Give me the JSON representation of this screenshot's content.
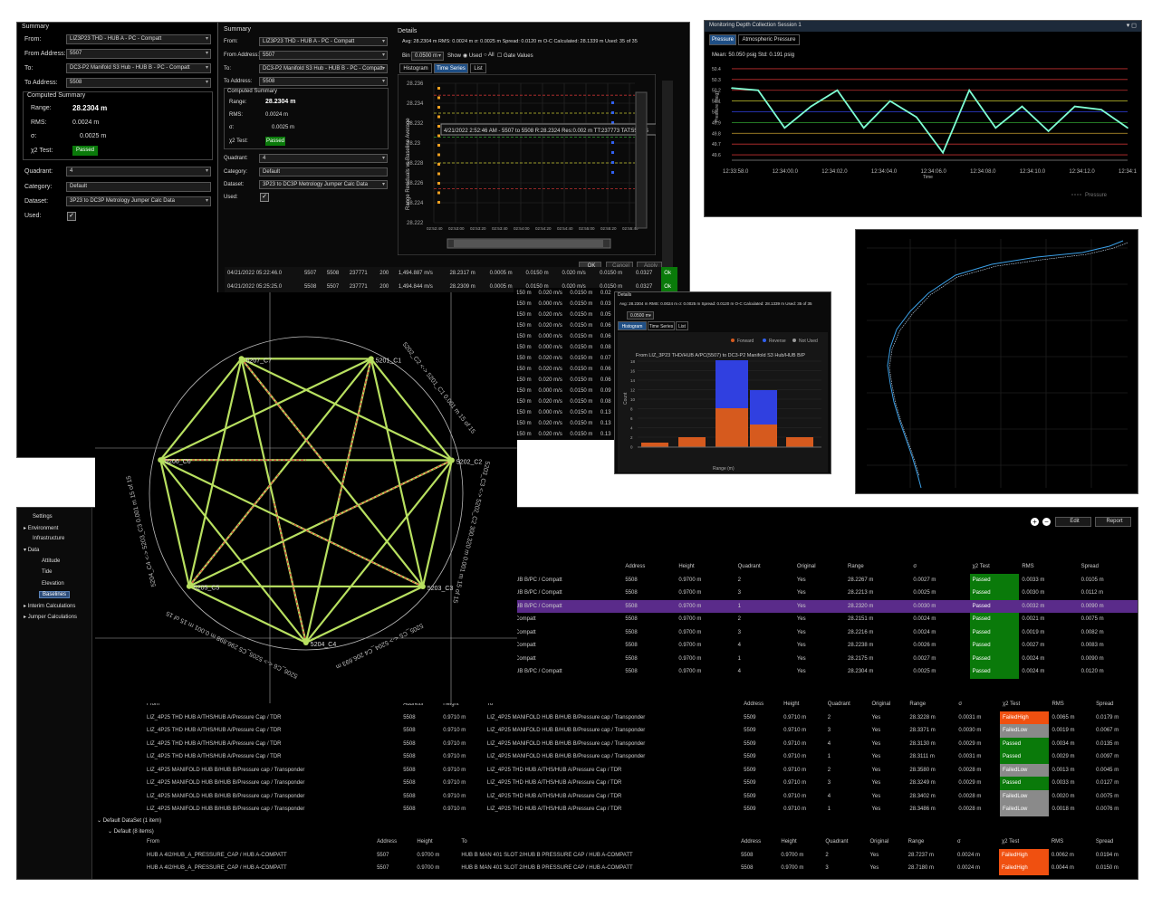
{
  "summary_panel": {
    "title": "Summary",
    "from_label": "From:",
    "from_value": "LIZ3P23 THD - HUB A - PC - Compatt",
    "from_address_label": "From Address:",
    "from_address_value": "5507",
    "to_label": "To:",
    "to_value": "DC3-P2 Manifold S3 Hub - HUB B - PC - Compatt",
    "to_address_label": "To Address:",
    "to_address_value": "5508",
    "computed_summary_title": "Computed Summary",
    "range_label": "Range:",
    "range_value": "28.2304 m",
    "rms_label": "RMS:",
    "rms_value": "0.0024 m",
    "sigma_label": "σ:",
    "sigma_value": "0.0025 m",
    "chi_label": "χ2 Test:",
    "chi_value": "Passed",
    "quadrant_label": "Quadrant:",
    "quadrant_value": "4",
    "category_label": "Category:",
    "category_value": "Default",
    "dataset_label": "Dataset:",
    "dataset_value": "3P23 to DC3P Metrology Jumper Calc Data",
    "used_label": "Used:"
  },
  "details_panel": {
    "title": "Details",
    "stats": "Avg: 28.2304 m  RMS: 0.0024 m  σ: 0.0025 m  Spread: 0.0120 m  O-C  Calculated: 28.1339 m  Used: 35 of 35",
    "bin_label": "Bin",
    "bin_value": "0.0500 m",
    "show_label": "Show",
    "used_option": "Used",
    "all_option": "All",
    "gate_label": "Gate Values",
    "tabs": [
      "Histogram",
      "Time Series",
      "List"
    ],
    "y_axis_label": "Range Residuals vs Baseline Average",
    "y_ticks": [
      "28.236",
      "28.234",
      "28.232",
      "28.23",
      "28.228",
      "28.226",
      "28.224",
      "28.222"
    ],
    "x_ticks": [
      "02:52:40",
      "02:53:00",
      "02:53:20",
      "02:53:40",
      "02:54:00",
      "02:54:20",
      "02:54:40",
      "02:55:00",
      "02:55:20",
      "02:55:40"
    ],
    "tooltip": "4/21/2022 2:52:46 AM - 5507 to 5508 R:28.2324 Res:0.002 m TT:237773 TAT:5508 S",
    "ok": "OK",
    "cancel": "Cancel",
    "apply": "Apply"
  },
  "bg_rows": [
    {
      "time": "04/21/2022 05:22:46.0",
      "a": "5507",
      "b": "5508",
      "c": "237771",
      "d": "200",
      "e": "1,494.887 m/s",
      "f": "28.2317 m",
      "g": "0.0005 m",
      "h": "0.0150 m",
      "i": "0.020 m/s",
      "j": "0.0150 m",
      "k": "0.0327",
      "ok": "Ok"
    },
    {
      "time": "04/21/2022 05:25:25.0",
      "a": "5508",
      "b": "5507",
      "c": "237771",
      "d": "200",
      "e": "1,494.844 m/s",
      "f": "28.2309 m",
      "g": "0.0005 m",
      "h": "0.0150 m",
      "i": "0.020 m/s",
      "j": "0.0150 m",
      "k": "0.0327",
      "ok": "Ok"
    }
  ],
  "mid_rows": [
    [
      "150 m",
      "0.020 m/s",
      "0.0150 m",
      "0.02"
    ],
    [
      "150 m",
      "0.000 m/s",
      "0.0150 m",
      "0.03"
    ],
    [
      "150 m",
      "0.020 m/s",
      "0.0150 m",
      "0.05"
    ],
    [
      "150 m",
      "0.020 m/s",
      "0.0150 m",
      "0.06"
    ],
    [
      "150 m",
      "0.000 m/s",
      "0.0150 m",
      "0.06"
    ],
    [
      "150 m",
      "0.000 m/s",
      "0.0150 m",
      "0.08"
    ],
    [
      "150 m",
      "0.020 m/s",
      "0.0150 m",
      "0.07"
    ],
    [
      "150 m",
      "0.020 m/s",
      "0.0150 m",
      "0.06"
    ],
    [
      "150 m",
      "0.020 m/s",
      "0.0150 m",
      "0.06"
    ],
    [
      "150 m",
      "0.000 m/s",
      "0.0150 m",
      "0.09"
    ],
    [
      "150 m",
      "0.020 m/s",
      "0.0150 m",
      "0.08"
    ],
    [
      "150 m",
      "0.000 m/s",
      "0.0150 m",
      "0.13"
    ],
    [
      "150 m",
      "0.020 m/s",
      "0.0150 m",
      "0.13"
    ],
    [
      "150 m",
      "0.020 m/s",
      "0.0150 m",
      "0.13"
    ]
  ],
  "monitor": {
    "title": "Monitoring Depth Collection Session 1",
    "tabs": [
      "Pressure",
      "Atmospheric Pressure"
    ],
    "stats": "Mean: 50.050 psig  Std: 0.191 psig",
    "ylabel": "Pressure (psig)",
    "xlabel": "Time",
    "legend": "Pressure",
    "y_ticks": [
      "49.6",
      "49.7",
      "49.8",
      "49.9",
      "50",
      "50.1",
      "50.2",
      "50.3",
      "50.4"
    ],
    "x_ticks": [
      "12:33:58.0",
      "12:34:00.0",
      "12:34:02.0",
      "12:34:04.0",
      "12:34:06.0",
      "12:34:08.0",
      "12:34:10.0",
      "12:34:12.0",
      "12:34:1"
    ],
    "colors": {
      "line": "#7fffd4",
      "bg": "#000000"
    }
  },
  "histogram": {
    "title_row": "Details",
    "stats": "Avg: 28.2304 m  RMS: 0.0024 m  σ: 0.0025 m  Spread: 0.0120 m  O-C  Calculated: 28.1339 m  Used: 35 of 35",
    "bin_value": "0.0500 m",
    "tabs": [
      "Histogram",
      "Time Series",
      "List"
    ],
    "legend": [
      "Forward",
      "Reverse",
      "Not Used"
    ],
    "chart_title": "From LIZ_3P23 THD/HUB A/PC(5507) to DC3-P2 Manifold S3 Hub/HUB B/P",
    "ylabel": "Count",
    "xlabel": "Range (m)",
    "y_ticks": [
      "18",
      "16",
      "14",
      "12",
      "10",
      "8",
      "6",
      "4",
      "2",
      "0"
    ]
  },
  "chart_data": {
    "type": "line",
    "title": "",
    "xlabel": "Time",
    "ylabel": "Pressure (psig)",
    "x": [
      "12:33:58.0",
      "12:33:59.0",
      "12:34:00.0",
      "12:34:01.0",
      "12:34:02.0",
      "12:34:03.0",
      "12:34:04.0",
      "12:34:05.0",
      "12:34:06.0",
      "12:34:07.0",
      "12:34:08.0",
      "12:34:09.0",
      "12:34:10.0",
      "12:34:11.0",
      "12:34:12.0",
      "12:34:13.0"
    ],
    "series": [
      {
        "name": "Pressure",
        "values": [
          50.22,
          50.2,
          49.85,
          50.05,
          50.2,
          49.85,
          50.1,
          49.95,
          49.62,
          50.2,
          49.85,
          50.05,
          49.82,
          50.05,
          50.02,
          49.85
        ]
      }
    ],
    "ylim": [
      49.55,
      50.45
    ]
  },
  "network": {
    "nodes": [
      "5201_C1",
      "5202_C2",
      "5203_C3",
      "5204_C4",
      "5205_C5",
      "5206_C6",
      "5207_C7"
    ],
    "edge_labels": [
      "5202_C2 <-> 5201_C1 0.001 m 15 of 15",
      "5203_C3 <-> 5202_C2 300.320 m 0.001 m 15 of 15",
      "5205_C5 <-> 5204_C4 206.693 m",
      "5206_C6 <-> 5205_C5 296.898 m 0.001 m 15 of 15",
      "5204_C4 <-> 5203_C3 0.001 m 15 of 15"
    ]
  },
  "tree": {
    "items": [
      "Settings",
      "Environment",
      "Infrastructure",
      "Data",
      "Attitude",
      "Tide",
      "Elevation",
      "Baselines",
      "Interim Calculations",
      "Jumper Calculations"
    ]
  },
  "bottom": {
    "edit": "Edit",
    "report": "Report",
    "headers": [
      "Address",
      "Height",
      "Quadrant",
      "Original",
      "Range",
      "σ",
      "χ2 Test",
      "RMS",
      "Spread"
    ],
    "headers_full": [
      "From",
      "Address",
      "Height",
      "To",
      "Address",
      "Height",
      "Quadrant",
      "Original",
      "Range",
      "σ",
      "χ2 Test",
      "RMS",
      "Spread"
    ],
    "group1": [
      {
        "to": "UB B/PC / Compatt",
        "addr": "5508",
        "h": "0.9700 m",
        "q": "2",
        "o": "Yes",
        "r": "28.2267 m",
        "s": "0.0027 m",
        "t": "Passed",
        "rms": "0.0033 m",
        "sp": "0.0105 m"
      },
      {
        "to": "UB B/PC / Compatt",
        "addr": "5508",
        "h": "0.9700 m",
        "q": "3",
        "o": "Yes",
        "r": "28.2213 m",
        "s": "0.0025 m",
        "t": "Passed",
        "rms": "0.0030 m",
        "sp": "0.0112 m"
      },
      {
        "to": "UB B/PC / Compatt",
        "addr": "5508",
        "h": "0.9700 m",
        "q": "1",
        "o": "Yes",
        "r": "28.2320 m",
        "s": "0.0030 m",
        "t": "Passed",
        "rms": "0.0032 m",
        "sp": "0.0090 m"
      },
      {
        "to": "Compatt",
        "addr": "5508",
        "h": "0.9700 m",
        "q": "2",
        "o": "Yes",
        "r": "28.2151 m",
        "s": "0.0024 m",
        "t": "Passed",
        "rms": "0.0021 m",
        "sp": "0.0075 m"
      },
      {
        "to": "Compatt",
        "addr": "5508",
        "h": "0.9700 m",
        "q": "3",
        "o": "Yes",
        "r": "28.2216 m",
        "s": "0.0024 m",
        "t": "Passed",
        "rms": "0.0019 m",
        "sp": "0.0082 m"
      },
      {
        "to": "Compatt",
        "addr": "5508",
        "h": "0.9700 m",
        "q": "4",
        "o": "Yes",
        "r": "28.2238 m",
        "s": "0.0026 m",
        "t": "Passed",
        "rms": "0.0027 m",
        "sp": "0.0083 m"
      },
      {
        "to": "Compatt",
        "addr": "5508",
        "h": "0.9700 m",
        "q": "1",
        "o": "Yes",
        "r": "28.2175 m",
        "s": "0.0027 m",
        "t": "Passed",
        "rms": "0.0024 m",
        "sp": "0.0090 m"
      },
      {
        "to": "UB B/PC / Compatt",
        "addr": "5508",
        "h": "0.9700 m",
        "q": "4",
        "o": "Yes",
        "r": "28.2304 m",
        "s": "0.0025 m",
        "t": "Passed",
        "rms": "0.0024 m",
        "sp": "0.0120 m"
      }
    ],
    "group2": [
      {
        "from": "LIZ_4P25 THD HUB A/THS/HUB A/Pressure Cap / TDR",
        "fa": "5508",
        "fh": "0.9710 m",
        "to": "LIZ_4P25 MANIFOLD HUB B/HUB B/Pressure cap / Transponder",
        "addr": "5509",
        "h": "0.9710 m",
        "q": "2",
        "o": "Yes",
        "r": "28.3228 m",
        "s": "0.0031 m",
        "t": "FailedHigh",
        "rms": "0.0065 m",
        "sp": "0.0179 m"
      },
      {
        "from": "LIZ_4P25 THD HUB A/THS/HUB A/Pressure Cap / TDR",
        "fa": "5508",
        "fh": "0.9710 m",
        "to": "LIZ_4P25 MANIFOLD HUB B/HUB B/Pressure cap / Transponder",
        "addr": "5509",
        "h": "0.9710 m",
        "q": "3",
        "o": "Yes",
        "r": "28.3371 m",
        "s": "0.0030 m",
        "t": "FailedLow",
        "rms": "0.0019 m",
        "sp": "0.0067 m"
      },
      {
        "from": "LIZ_4P25 THD HUB A/THS/HUB A/Pressure Cap / TDR",
        "fa": "5508",
        "fh": "0.9710 m",
        "to": "LIZ_4P25 MANIFOLD HUB B/HUB B/Pressure cap / Transponder",
        "addr": "5509",
        "h": "0.9710 m",
        "q": "4",
        "o": "Yes",
        "r": "28.3130 m",
        "s": "0.0029 m",
        "t": "Passed",
        "rms": "0.0034 m",
        "sp": "0.0135 m"
      },
      {
        "from": "LIZ_4P25 THD HUB A/THS/HUB A/Pressure Cap / TDR",
        "fa": "5508",
        "fh": "0.9710 m",
        "to": "LIZ_4P25 MANIFOLD HUB B/HUB B/Pressure cap / Transponder",
        "addr": "5509",
        "h": "0.9710 m",
        "q": "1",
        "o": "Yes",
        "r": "28.3111 m",
        "s": "0.0031 m",
        "t": "Passed",
        "rms": "0.0029 m",
        "sp": "0.0097 m"
      },
      {
        "from": "LIZ_4P25 MANIFOLD HUB B/HUB B/Pressure cap / Transponder",
        "fa": "5508",
        "fh": "0.9710 m",
        "to": "LIZ_4P25 THD HUB A/THS/HUB A/Pressure Cap / TDR",
        "addr": "5509",
        "h": "0.9710 m",
        "q": "2",
        "o": "Yes",
        "r": "28.3580 m",
        "s": "0.0028 m",
        "t": "FailedLow",
        "rms": "0.0013 m",
        "sp": "0.0045 m"
      },
      {
        "from": "LIZ_4P25 MANIFOLD HUB B/HUB B/Pressure cap / Transponder",
        "fa": "5508",
        "fh": "0.9710 m",
        "to": "LIZ_4P25 THD HUB A/THS/HUB A/Pressure Cap / TDR",
        "addr": "5509",
        "h": "0.9710 m",
        "q": "3",
        "o": "Yes",
        "r": "28.3249 m",
        "s": "0.0029 m",
        "t": "Passed",
        "rms": "0.0033 m",
        "sp": "0.0127 m"
      },
      {
        "from": "LIZ_4P25 MANIFOLD HUB B/HUB B/Pressure cap / Transponder",
        "fa": "5508",
        "fh": "0.9710 m",
        "to": "LIZ_4P25 THD HUB A/THS/HUB A/Pressure Cap / TDR",
        "addr": "5509",
        "h": "0.9710 m",
        "q": "4",
        "o": "Yes",
        "r": "28.3402 m",
        "s": "0.0028 m",
        "t": "FailedLow",
        "rms": "0.0020 m",
        "sp": "0.0075 m"
      },
      {
        "from": "LIZ_4P25 MANIFOLD HUB B/HUB B/Pressure cap / Transponder",
        "fa": "5508",
        "fh": "0.9710 m",
        "to": "LIZ_4P25 THD HUB A/THS/HUB A/Pressure Cap / TDR",
        "addr": "5509",
        "h": "0.9710 m",
        "q": "1",
        "o": "Yes",
        "r": "28.3486 m",
        "s": "0.0028 m",
        "t": "FailedLow",
        "rms": "0.0018 m",
        "sp": "0.0076 m"
      }
    ],
    "dataset_group": "Default DataSet (1 item)",
    "default_group": "Default (8 items)",
    "group3": [
      {
        "from": "HUB A 4I2/HUB_A_PRESSURE_CAP / HUB A-COMPATT",
        "fa": "5507",
        "fh": "0.9700 m",
        "to": "HUB B MAN 401 SLOT 2/HUB B PRESSURE CAP / HUB A-COMPATT",
        "addr": "5508",
        "h": "0.9700 m",
        "q": "2",
        "o": "Yes",
        "r": "28.7237 m",
        "s": "0.0024 m",
        "t": "FailedHigh",
        "rms": "0.0062 m",
        "sp": "0.0194 m"
      },
      {
        "from": "HUB A 4I2/HUB_A_PRESSURE_CAP / HUB A-COMPATT",
        "fa": "5507",
        "fh": "0.9700 m",
        "to": "HUB B MAN 401 SLOT 2/HUB B PRESSURE CAP / HUB A-COMPATT",
        "addr": "5508",
        "h": "0.9700 m",
        "q": "3",
        "o": "Yes",
        "r": "28.7180 m",
        "s": "0.0024 m",
        "t": "FailedHigh",
        "rms": "0.0044 m",
        "sp": "0.0150 m"
      }
    ]
  }
}
